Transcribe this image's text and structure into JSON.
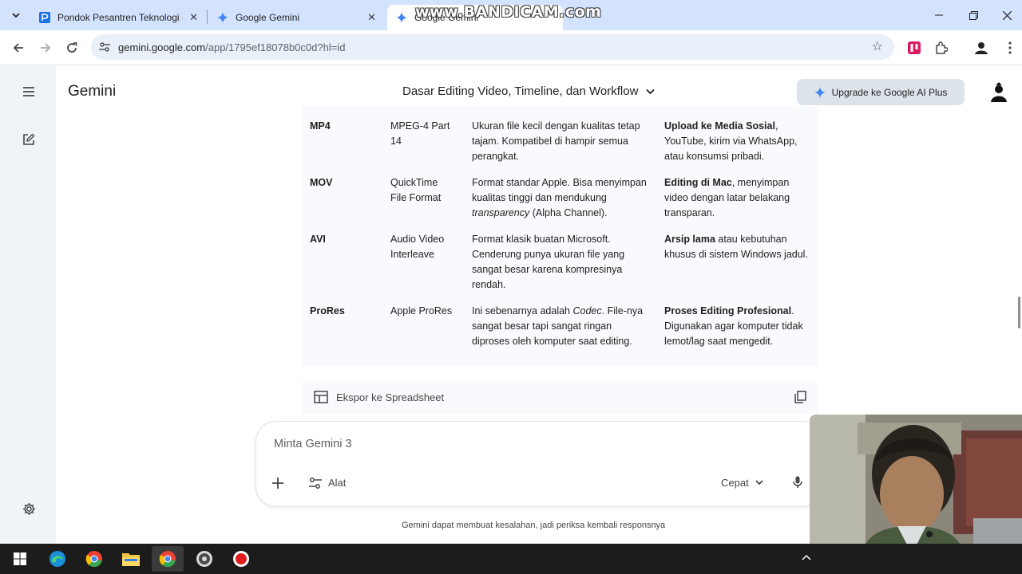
{
  "browser": {
    "tabs": [
      {
        "title": "Pondok Pesantren Teknologi - A",
        "active": false,
        "favicon": "pondok-site-icon"
      },
      {
        "title": "Google Gemini",
        "active": false,
        "favicon": "gemini-spark-icon"
      },
      {
        "title": "Google Gemini",
        "active": true,
        "favicon": "gemini-spark-icon"
      }
    ],
    "watermark": "www.BANDICAM.com",
    "url_host": "gemini.google.com",
    "url_path": "/app/1795ef18078b0c0d?hl=id"
  },
  "app": {
    "brand": "Gemini",
    "chat_title": "Dasar Editing Video, Timeline, dan Workflow",
    "upgrade_label": "Upgrade ke Google AI Plus"
  },
  "table": {
    "rows": [
      {
        "format": "MP4",
        "name": "MPEG-4 Part 14",
        "desc": [
          {
            "t": "Ukuran file kecil dengan kualitas tetap tajam. Kompatibel di hampir semua perangkat."
          }
        ],
        "use": [
          {
            "t": "Upload ke Media Sosial",
            "b": true
          },
          {
            "t": ", YouTube, kirim via WhatsApp, atau konsumsi pribadi."
          }
        ]
      },
      {
        "format": "MOV",
        "name": "QuickTime File Format",
        "desc": [
          {
            "t": "Format standar Apple. Bisa menyimpan kualitas tinggi dan mendukung "
          },
          {
            "t": "transparency",
            "i": true
          },
          {
            "t": " (Alpha Channel)."
          }
        ],
        "use": [
          {
            "t": "Editing di Mac",
            "b": true
          },
          {
            "t": ", menyimpan video dengan latar belakang transparan."
          }
        ]
      },
      {
        "format": "AVI",
        "name": "Audio Video Interleave",
        "desc": [
          {
            "t": "Format klasik buatan Microsoft. Cenderung punya ukuran file yang sangat besar karena kompresinya rendah."
          }
        ],
        "use": [
          {
            "t": "Arsip lama",
            "b": true
          },
          {
            "t": " atau kebutuhan khusus di sistem Windows jadul."
          }
        ]
      },
      {
        "format": "ProRes",
        "name": "Apple ProRes",
        "desc": [
          {
            "t": "Ini sebenarnya adalah "
          },
          {
            "t": "Codec",
            "i": true
          },
          {
            "t": ". File-nya sangat besar tapi sangat ringan diproses oleh komputer saat editing."
          }
        ],
        "use": [
          {
            "t": "Proses Editing Profesional",
            "b": true
          },
          {
            "t": ". Digunakan agar komputer tidak lemot/lag saat mengedit."
          }
        ]
      }
    ],
    "export_label": "Ekspor ke Spreadsheet"
  },
  "prompt": {
    "placeholder": "Minta Gemini 3",
    "tools_label": "Alat",
    "mode_label": "Cepat"
  },
  "disclaimer": "Gemini dapat membuat kesalahan, jadi periksa kembali responsnya",
  "colors": {
    "tab_strip": "#d3e3fd",
    "sidebar": "#f0f4f9",
    "table_bg": "#f8fafd",
    "upgrade_bg": "#dde3ea",
    "taskbar": "#1c1c1c"
  }
}
